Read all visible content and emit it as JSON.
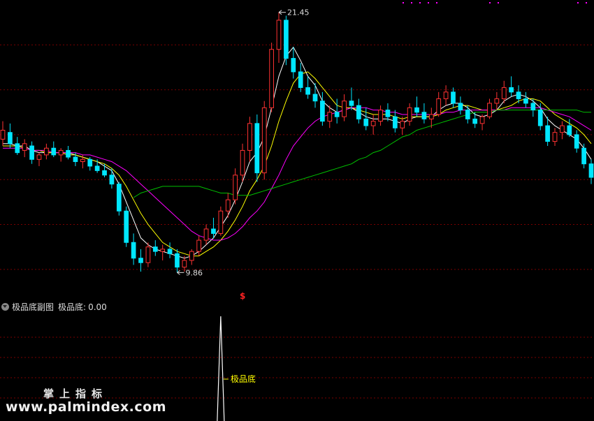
{
  "chart_data": [
    {
      "type": "candlestick",
      "role": "main-price-panel",
      "y_range": [
        9.0,
        22.0
      ],
      "grid": "horizontal dashed",
      "annotations": [
        {
          "text": "21.45",
          "kind": "high-marker",
          "x_index": 38,
          "y": 21.45
        },
        {
          "text": "9.86",
          "kind": "low-marker",
          "x_index": 24,
          "y": 9.86
        },
        {
          "text": "$",
          "kind": "signal-marker",
          "x_index": 33
        }
      ],
      "ohlc": [
        [
          15.8,
          16.6,
          15.5,
          16.2
        ],
        [
          16.1,
          16.5,
          15.4,
          15.6
        ],
        [
          15.6,
          15.9,
          15.1,
          15.2
        ],
        [
          15.3,
          15.8,
          15.0,
          15.6
        ],
        [
          15.5,
          15.7,
          14.7,
          14.9
        ],
        [
          14.9,
          15.2,
          14.6,
          15.1
        ],
        [
          15.1,
          15.6,
          14.9,
          15.4
        ],
        [
          15.4,
          15.7,
          15.0,
          15.1
        ],
        [
          15.1,
          15.4,
          14.8,
          15.3
        ],
        [
          15.3,
          15.5,
          14.9,
          15.0
        ],
        [
          15.0,
          15.2,
          14.6,
          14.8
        ],
        [
          14.8,
          15.1,
          14.5,
          14.9
        ],
        [
          14.9,
          15.0,
          14.4,
          14.6
        ],
        [
          14.6,
          14.9,
          14.3,
          14.4
        ],
        [
          14.4,
          14.7,
          14.1,
          14.2
        ],
        [
          14.2,
          14.5,
          13.6,
          13.8
        ],
        [
          13.8,
          13.9,
          12.4,
          12.6
        ],
        [
          12.6,
          12.8,
          11.0,
          11.2
        ],
        [
          11.2,
          11.6,
          10.2,
          10.5
        ],
        [
          10.5,
          10.9,
          9.9,
          10.3
        ],
        [
          10.3,
          11.2,
          10.1,
          11.0
        ],
        [
          11.0,
          11.3,
          10.6,
          10.8
        ],
        [
          10.8,
          11.1,
          10.4,
          10.9
        ],
        [
          10.9,
          11.2,
          10.5,
          10.7
        ],
        [
          10.7,
          10.9,
          9.86,
          10.1
        ],
        [
          10.1,
          10.6,
          9.9,
          10.4
        ],
        [
          10.4,
          10.9,
          10.2,
          10.8
        ],
        [
          10.8,
          11.5,
          10.6,
          11.3
        ],
        [
          11.3,
          12.0,
          11.1,
          11.8
        ],
        [
          11.8,
          12.3,
          11.4,
          11.6
        ],
        [
          11.6,
          12.8,
          11.5,
          12.6
        ],
        [
          12.6,
          13.4,
          12.3,
          13.1
        ],
        [
          13.1,
          14.5,
          12.9,
          14.2
        ],
        [
          14.2,
          15.6,
          13.9,
          15.3
        ],
        [
          15.3,
          16.8,
          14.8,
          16.5
        ],
        [
          16.5,
          16.9,
          13.9,
          14.3
        ],
        [
          14.3,
          17.5,
          14.0,
          17.2
        ],
        [
          17.2,
          20.1,
          17.0,
          19.8
        ],
        [
          19.8,
          21.45,
          19.2,
          21.1
        ],
        [
          21.1,
          21.3,
          19.1,
          19.4
        ],
        [
          19.4,
          19.9,
          18.5,
          18.8
        ],
        [
          18.8,
          19.2,
          17.9,
          18.1
        ],
        [
          18.1,
          18.6,
          17.6,
          17.8
        ],
        [
          17.8,
          18.3,
          17.2,
          17.5
        ],
        [
          17.5,
          17.9,
          16.4,
          16.6
        ],
        [
          16.6,
          17.3,
          16.3,
          17.0
        ],
        [
          17.0,
          17.6,
          16.5,
          16.8
        ],
        [
          16.8,
          17.8,
          16.6,
          17.5
        ],
        [
          17.5,
          18.1,
          17.1,
          17.3
        ],
        [
          17.3,
          17.6,
          16.5,
          16.7
        ],
        [
          16.7,
          17.2,
          16.2,
          16.4
        ],
        [
          16.4,
          16.9,
          16.0,
          16.6
        ],
        [
          16.6,
          17.3,
          16.4,
          17.1
        ],
        [
          17.1,
          17.4,
          16.6,
          16.8
        ],
        [
          16.8,
          17.1,
          16.1,
          16.3
        ],
        [
          16.3,
          16.8,
          16.0,
          16.6
        ],
        [
          16.6,
          17.4,
          16.4,
          17.2
        ],
        [
          17.2,
          17.7,
          16.8,
          17.0
        ],
        [
          17.0,
          17.4,
          16.5,
          16.7
        ],
        [
          16.7,
          17.2,
          16.3,
          16.9
        ],
        [
          16.9,
          17.9,
          16.8,
          17.6
        ],
        [
          17.6,
          18.2,
          17.3,
          17.9
        ],
        [
          17.9,
          18.1,
          17.2,
          17.4
        ],
        [
          17.4,
          17.7,
          16.9,
          17.1
        ],
        [
          17.1,
          17.3,
          16.5,
          16.7
        ],
        [
          16.7,
          17.0,
          16.3,
          16.5
        ],
        [
          16.5,
          16.9,
          16.2,
          16.8
        ],
        [
          16.8,
          17.6,
          16.7,
          17.4
        ],
        [
          17.4,
          17.9,
          17.1,
          17.6
        ],
        [
          17.6,
          18.4,
          17.4,
          18.1
        ],
        [
          18.1,
          18.6,
          17.7,
          17.9
        ],
        [
          17.9,
          18.2,
          17.4,
          17.6
        ],
        [
          17.6,
          17.9,
          17.2,
          17.4
        ],
        [
          17.4,
          17.6,
          16.8,
          17.1
        ],
        [
          17.1,
          17.4,
          16.2,
          16.4
        ],
        [
          16.4,
          16.8,
          15.5,
          15.7
        ],
        [
          15.7,
          16.3,
          15.5,
          16.1
        ],
        [
          16.1,
          16.6,
          15.8,
          16.4
        ],
        [
          16.4,
          16.7,
          15.9,
          16.0
        ],
        [
          16.0,
          16.2,
          15.2,
          15.4
        ],
        [
          15.4,
          15.6,
          14.5,
          14.7
        ],
        [
          14.7,
          14.9,
          13.8,
          14.1
        ]
      ],
      "ma_lines": [
        {
          "color": "#ffffff",
          "values": [
            15.6,
            15.6,
            15.5,
            15.5,
            15.3,
            15.2,
            15.2,
            15.2,
            15.2,
            15.2,
            15.1,
            15.0,
            14.9,
            14.8,
            14.6,
            14.4,
            13.8,
            13.0,
            12.2,
            11.4,
            11.1,
            10.9,
            10.8,
            10.7,
            10.6,
            10.5,
            10.6,
            10.8,
            11.1,
            11.4,
            11.9,
            12.4,
            13.1,
            13.9,
            14.8,
            15.2,
            15.9,
            17.2,
            18.6,
            19.5,
            19.9,
            19.3,
            18.6,
            18.2,
            17.5,
            17.2,
            17.0,
            17.1,
            17.2,
            17.0,
            16.8,
            16.7,
            16.7,
            16.7,
            16.6,
            16.5,
            16.7,
            16.8,
            16.8,
            16.8,
            17.1,
            17.3,
            17.4,
            17.4,
            17.2,
            16.9,
            16.8,
            16.9,
            17.1,
            17.5,
            17.7,
            17.8,
            17.7,
            17.5,
            17.2,
            16.7,
            16.4,
            16.2,
            16.0,
            15.8,
            15.4,
            14.9
          ]
        },
        {
          "color": "#ffff00",
          "values": [
            15.5,
            15.5,
            15.5,
            15.4,
            15.3,
            15.3,
            15.2,
            15.2,
            15.2,
            15.1,
            15.1,
            15.0,
            14.9,
            14.8,
            14.7,
            14.5,
            14.2,
            13.7,
            13.1,
            12.5,
            12.0,
            11.6,
            11.2,
            11.0,
            10.8,
            10.7,
            10.6,
            10.6,
            10.8,
            11.0,
            11.3,
            11.7,
            12.2,
            12.8,
            13.5,
            14.0,
            14.6,
            15.5,
            16.6,
            17.5,
            18.3,
            18.7,
            18.8,
            18.5,
            18.1,
            17.7,
            17.3,
            17.2,
            17.2,
            17.1,
            17.0,
            16.9,
            16.9,
            16.9,
            16.8,
            16.7,
            16.8,
            16.8,
            16.8,
            16.8,
            16.9,
            17.1,
            17.2,
            17.3,
            17.3,
            17.2,
            17.1,
            17.1,
            17.1,
            17.2,
            17.3,
            17.5,
            17.6,
            17.6,
            17.5,
            17.2,
            16.9,
            16.7,
            16.5,
            16.3,
            16.0,
            15.6
          ]
        },
        {
          "color": "#ff00ff",
          "values": [
            15.4,
            15.4,
            15.4,
            15.4,
            15.3,
            15.3,
            15.3,
            15.2,
            15.2,
            15.2,
            15.2,
            15.1,
            15.1,
            15.0,
            14.9,
            14.8,
            14.6,
            14.4,
            14.1,
            13.8,
            13.5,
            13.2,
            12.9,
            12.6,
            12.3,
            12.0,
            11.7,
            11.5,
            11.4,
            11.3,
            11.3,
            11.4,
            11.6,
            11.9,
            12.3,
            12.6,
            13.0,
            13.6,
            14.2,
            14.9,
            15.5,
            15.9,
            16.3,
            16.6,
            16.8,
            16.9,
            17.0,
            17.1,
            17.2,
            17.2,
            17.2,
            17.1,
            17.1,
            17.0,
            17.0,
            16.9,
            16.9,
            16.9,
            16.9,
            16.9,
            16.9,
            17.0,
            17.0,
            17.1,
            17.1,
            17.1,
            17.1,
            17.1,
            17.1,
            17.1,
            17.2,
            17.2,
            17.2,
            17.2,
            17.2,
            17.1,
            17.0,
            16.9,
            16.8,
            16.6,
            16.4,
            16.2
          ]
        },
        {
          "color": "#00c000",
          "start_index": 18,
          "values": [
            13.2,
            13.4,
            13.5,
            13.6,
            13.7,
            13.7,
            13.7,
            13.7,
            13.7,
            13.7,
            13.6,
            13.5,
            13.4,
            13.4,
            13.3,
            13.3,
            13.3,
            13.4,
            13.5,
            13.6,
            13.7,
            13.8,
            13.9,
            14.0,
            14.1,
            14.2,
            14.3,
            14.4,
            14.5,
            14.6,
            14.7,
            14.9,
            15.0,
            15.2,
            15.3,
            15.5,
            15.7,
            15.9,
            16.0,
            16.2,
            16.3,
            16.4,
            16.5,
            16.6,
            16.7,
            16.8,
            16.9,
            17.0,
            17.0,
            17.0,
            17.1,
            17.1,
            17.1,
            17.1,
            17.1,
            17.1,
            17.1,
            17.1,
            17.1,
            17.1,
            17.1,
            17.1,
            17.0,
            17.0
          ]
        }
      ]
    },
    {
      "type": "line",
      "role": "indicator-sub-panel",
      "series": [
        {
          "name": "极品底",
          "peak_index": 30
        }
      ],
      "y_range": [
        0,
        100
      ],
      "peak_label": "极品底"
    }
  ],
  "sub_header": {
    "indicator_title": "极品底副图",
    "value_label": "极品底:",
    "value": "0.00"
  },
  "watermark": {
    "text_cn": "掌上指标",
    "url": "www.palmindex.com"
  },
  "colors": {
    "up": "#ff3232",
    "down": "#00e6ff",
    "grid": "#7a0000",
    "separator": "#b00000",
    "annotation": "#dddddd",
    "signal": "#ff2222",
    "indicator_line": "#ffffff",
    "indicator_label": "#ffff00",
    "corner_dots": "#ff00ff"
  }
}
